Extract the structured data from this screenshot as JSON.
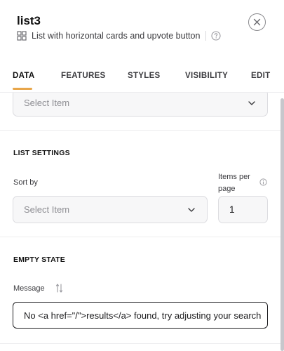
{
  "panel": {
    "title": "list3",
    "subtitle": "List with horizontal cards and upvote button"
  },
  "tabs": [
    {
      "label": "DATA",
      "active": true
    },
    {
      "label": "FEATURES",
      "active": false
    },
    {
      "label": "STYLES",
      "active": false
    },
    {
      "label": "VISIBILITY",
      "active": false
    },
    {
      "label": "EDIT",
      "active": false
    }
  ],
  "data_source": {
    "placeholder": "Select Item"
  },
  "list_settings": {
    "section_title": "LIST SETTINGS",
    "sort_by_label": "Sort by",
    "sort_by_placeholder": "Select Item",
    "items_per_page_label": "Items per page",
    "items_per_page_value": "1"
  },
  "empty_state": {
    "section_title": "EMPTY STATE",
    "message_label": "Message",
    "message_value": "No <a href=\"/\">results</a> found, try adjusting your search"
  },
  "colors": {
    "accent": "#e8a64a",
    "border": "#dcdce0",
    "input_bg": "#f7f7f8"
  },
  "icons": [
    "grid-icon",
    "help-circle-icon",
    "close-icon",
    "chevron-down-icon",
    "info-icon",
    "dynamic-value-icon"
  ]
}
